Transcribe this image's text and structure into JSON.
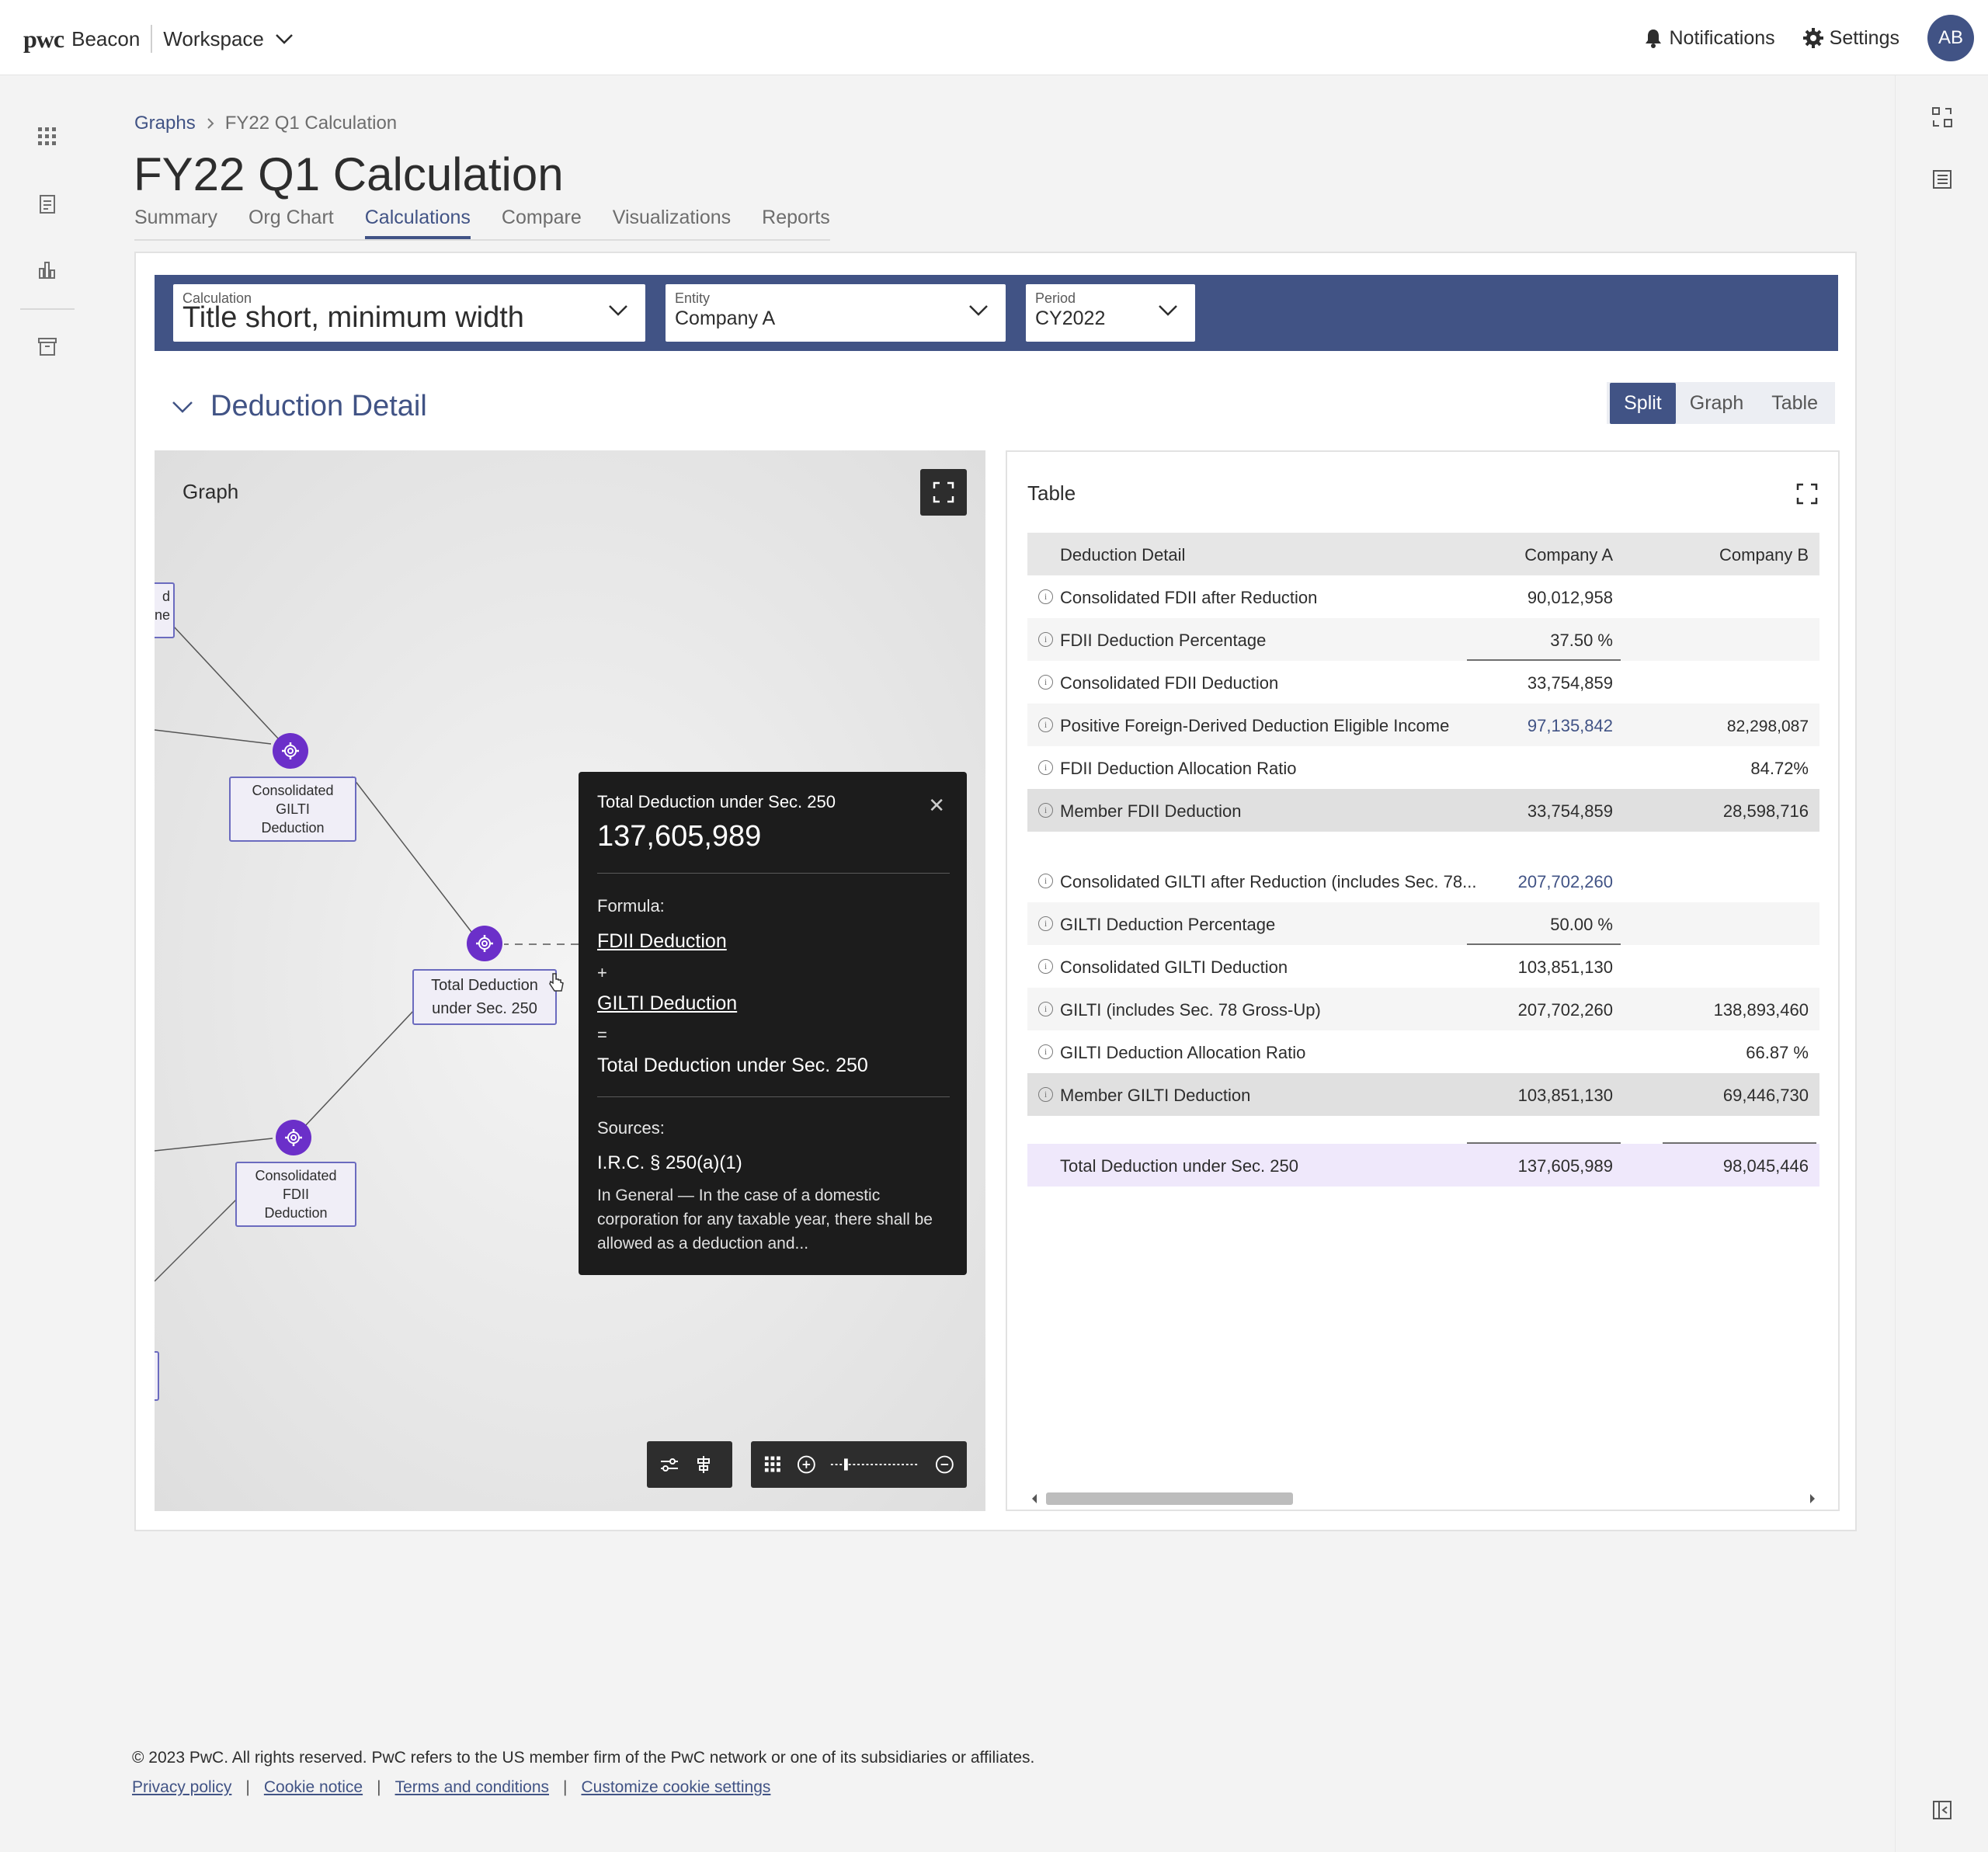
{
  "header": {
    "brand_pwc": "pwc",
    "brand_name": "Beacon",
    "workspace_label": "Workspace",
    "notifications_label": "Notifications",
    "settings_label": "Settings",
    "avatar_initials": "AB"
  },
  "breadcrumb": {
    "parent": "Graphs",
    "current": "FY22 Q1 Calculation"
  },
  "page_title": "FY22 Q1 Calculation",
  "tabs": [
    {
      "label": "Summary",
      "active": false
    },
    {
      "label": "Org Chart",
      "active": false
    },
    {
      "label": "Calculations",
      "active": true
    },
    {
      "label": "Compare",
      "active": false
    },
    {
      "label": "Visualizations",
      "active": false
    },
    {
      "label": "Reports",
      "active": false
    }
  ],
  "filters": {
    "calculation": {
      "label": "Calculation",
      "value": "Title short, minimum width"
    },
    "entity": {
      "label": "Entity",
      "value": "Company A"
    },
    "period": {
      "label": "Period",
      "value": "CY2022"
    }
  },
  "section": {
    "title": "Deduction Detail",
    "view_options": [
      "Split",
      "Graph",
      "Table"
    ],
    "active_view": "Split"
  },
  "graph": {
    "title": "Graph",
    "partial_label_top": [
      "d",
      "ne"
    ],
    "nodes": {
      "gilti": [
        "Consolidated GILTI",
        "Deduction"
      ],
      "total": [
        "Total Deduction",
        "under Sec. 250"
      ],
      "fdii": [
        "Consolidated FDII",
        "Deduction"
      ]
    }
  },
  "tooltip": {
    "title": "Total Deduction under Sec. 250",
    "value": "137,605,989",
    "formula_label": "Formula:",
    "term1": "FDII Deduction",
    "op1": "+",
    "term2": "GILTI Deduction",
    "op2": "=",
    "result": "Total Deduction under  Sec. 250",
    "sources_label": "Sources:",
    "source_ref": "I.R.C. § 250(a)(1)",
    "source_desc": "In General — In the case of a domestic corporation for any taxable year, there shall be allowed as a deduction and..."
  },
  "table": {
    "title": "Table",
    "columns": [
      "Deduction Detail",
      "Company A",
      "Company B"
    ],
    "rows": [
      {
        "name": "Consolidated FDII after Reduction",
        "a": "90,012,958",
        "b": ""
      },
      {
        "name": "FDII Deduction Percentage",
        "a": "37.50 %",
        "b": ""
      },
      {
        "name": "Consolidated FDII Deduction",
        "a": "33,754,859",
        "b": ""
      },
      {
        "name": "Positive Foreign-Derived Deduction Eligible Income",
        "a": "97,135,842",
        "b": "82,298,087"
      },
      {
        "name": "FDII Deduction Allocation Ratio",
        "a": "",
        "b": "84.72%"
      },
      {
        "name": "Member FDII Deduction",
        "a": "33,754,859",
        "b": "28,598,716"
      },
      {
        "name": "Consolidated GILTI after Reduction (includes Sec. 78...",
        "a": "207,702,260",
        "b": ""
      },
      {
        "name": "GILTI Deduction Percentage",
        "a": "50.00 %",
        "b": ""
      },
      {
        "name": "Consolidated GILTI Deduction",
        "a": "103,851,130",
        "b": ""
      },
      {
        "name": "GILTI (includes Sec. 78 Gross-Up)",
        "a": "207,702,260",
        "b": "138,893,460"
      },
      {
        "name": "GILTI Deduction Allocation Ratio",
        "a": "",
        "b": "66.87 %"
      },
      {
        "name": "Member GILTI Deduction",
        "a": "103,851,130",
        "b": "69,446,730"
      },
      {
        "name": "Total Deduction under Sec. 250",
        "a": "137,605,989",
        "b": "98,045,446"
      }
    ]
  },
  "footer": {
    "copyright": "© 2023 PwC. All rights reserved. PwC refers to the US member firm of the PwC network or one of its subsidiaries or affiliates.",
    "links": [
      "Privacy policy",
      "Cookie notice",
      "Terms and conditions",
      "Customize cookie settings"
    ]
  },
  "colors": {
    "brand": "#415385",
    "node": "#6b2fc9",
    "total_row": "#efe8fb",
    "tooltip_bg": "#1c1c1c"
  }
}
